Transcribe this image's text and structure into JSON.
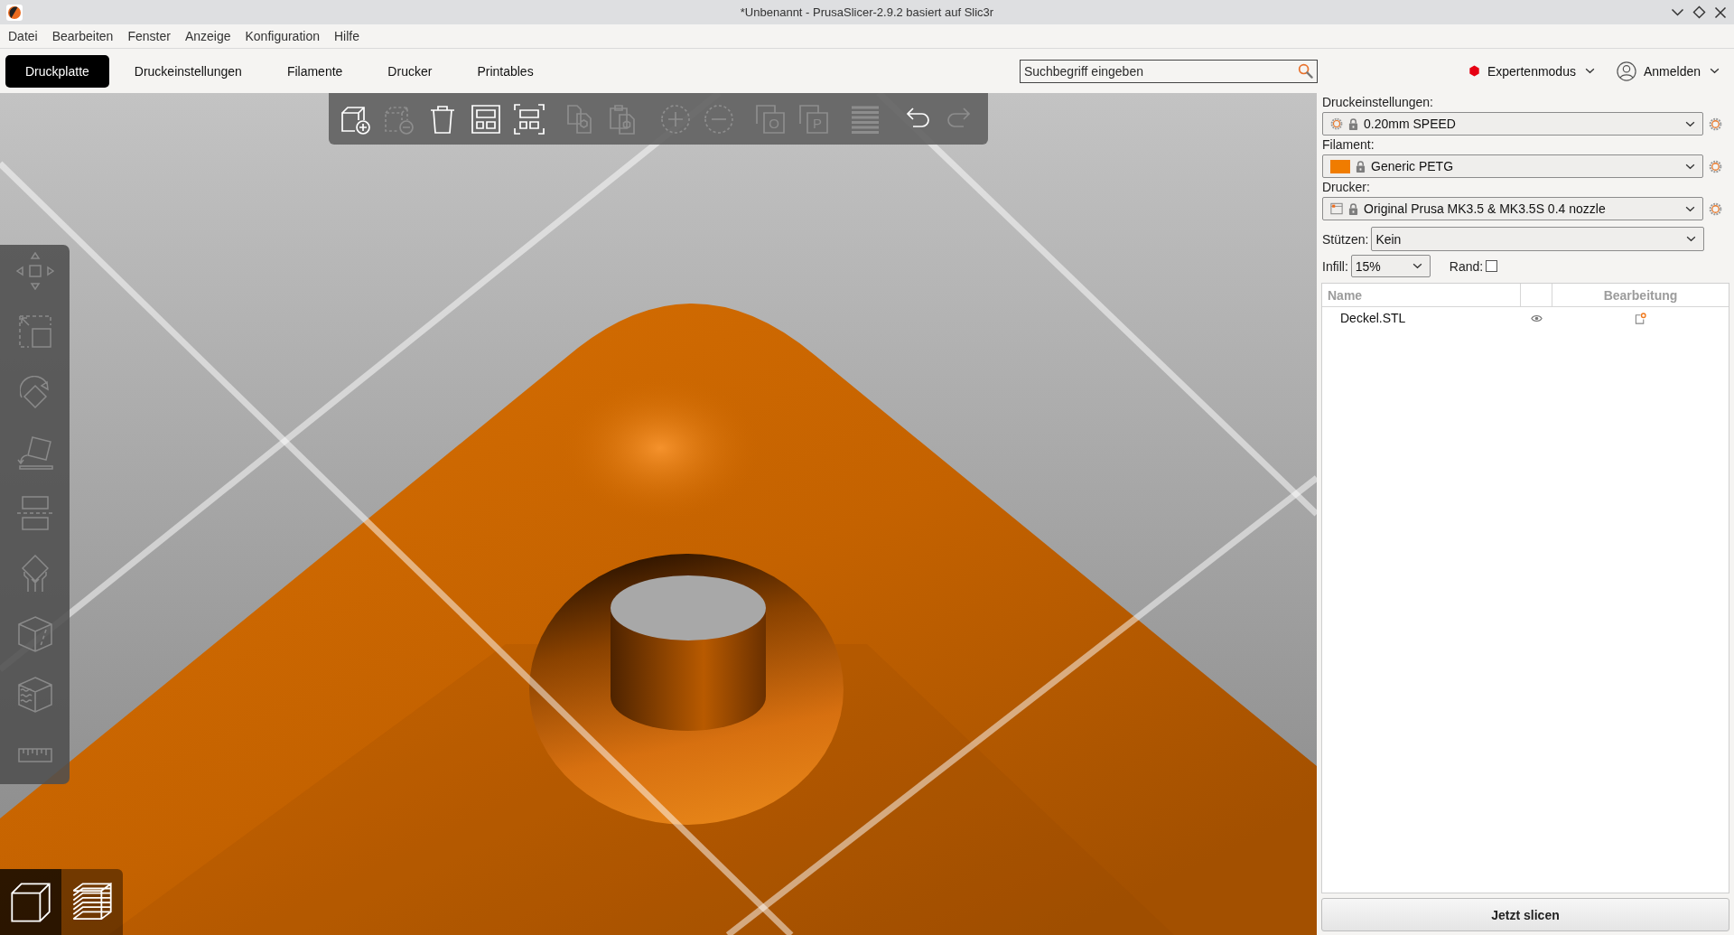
{
  "window": {
    "title": "*Unbenannt - PrusaSlicer-2.9.2 basiert auf Slic3r"
  },
  "menu": [
    "Datei",
    "Bearbeiten",
    "Fenster",
    "Anzeige",
    "Konfiguration",
    "Hilfe"
  ],
  "tabs": [
    {
      "label": "Druckplatte",
      "selected": true
    },
    {
      "label": "Druckeinstellungen",
      "selected": false
    },
    {
      "label": "Filamente",
      "selected": false
    },
    {
      "label": "Drucker",
      "selected": false
    },
    {
      "label": "Printables",
      "selected": false
    }
  ],
  "search": {
    "placeholder": "Suchbegriff eingeben"
  },
  "mode": {
    "label": "Expertenmodus"
  },
  "account": {
    "label": "Anmelden"
  },
  "toolbar": [
    {
      "disabled": false
    },
    {
      "disabled": true
    },
    {
      "disabled": false
    },
    {
      "disabled": false
    },
    {
      "disabled": false
    },
    {
      "disabled": true
    },
    {
      "disabled": true
    },
    {
      "disabled": true
    },
    {
      "disabled": true
    },
    {
      "disabled": true,
      "glyph": "O"
    },
    {
      "disabled": true,
      "glyph": "P"
    },
    {
      "disabled": true
    },
    {
      "disabled": false
    },
    {
      "disabled": true
    }
  ],
  "gizmos": [
    {
      "disabled": true
    },
    {
      "disabled": true
    },
    {
      "disabled": true
    },
    {
      "disabled": true
    },
    {
      "disabled": true
    },
    {
      "disabled": true
    },
    {
      "disabled": true
    },
    {
      "disabled": true
    },
    {
      "disabled": true
    }
  ],
  "view_toggle": [
    {
      "selected": true
    },
    {
      "selected": false
    }
  ],
  "presets": [
    {
      "kind": "print",
      "label": "Druckeinstellungen:",
      "value": "0.20mm SPEED"
    },
    {
      "kind": "filament",
      "label": "Filament:",
      "value": "Generic PETG",
      "color": "#f07c00"
    },
    {
      "kind": "printer",
      "label": "Drucker:",
      "value": "Original Prusa MK3.5 & MK3.5S 0.4 nozzle"
    }
  ],
  "supports": {
    "label": "Stützen:",
    "value": "Kein"
  },
  "infill": {
    "label": "Infill:",
    "value": "15%"
  },
  "brim": {
    "label": "Rand:",
    "checked": false
  },
  "object_list": {
    "columns": [
      "Name",
      "Bearbeitung"
    ],
    "rows": [
      {
        "name": "Deckel.STL"
      }
    ]
  },
  "slice_button": {
    "label": "Jetzt slicen"
  }
}
